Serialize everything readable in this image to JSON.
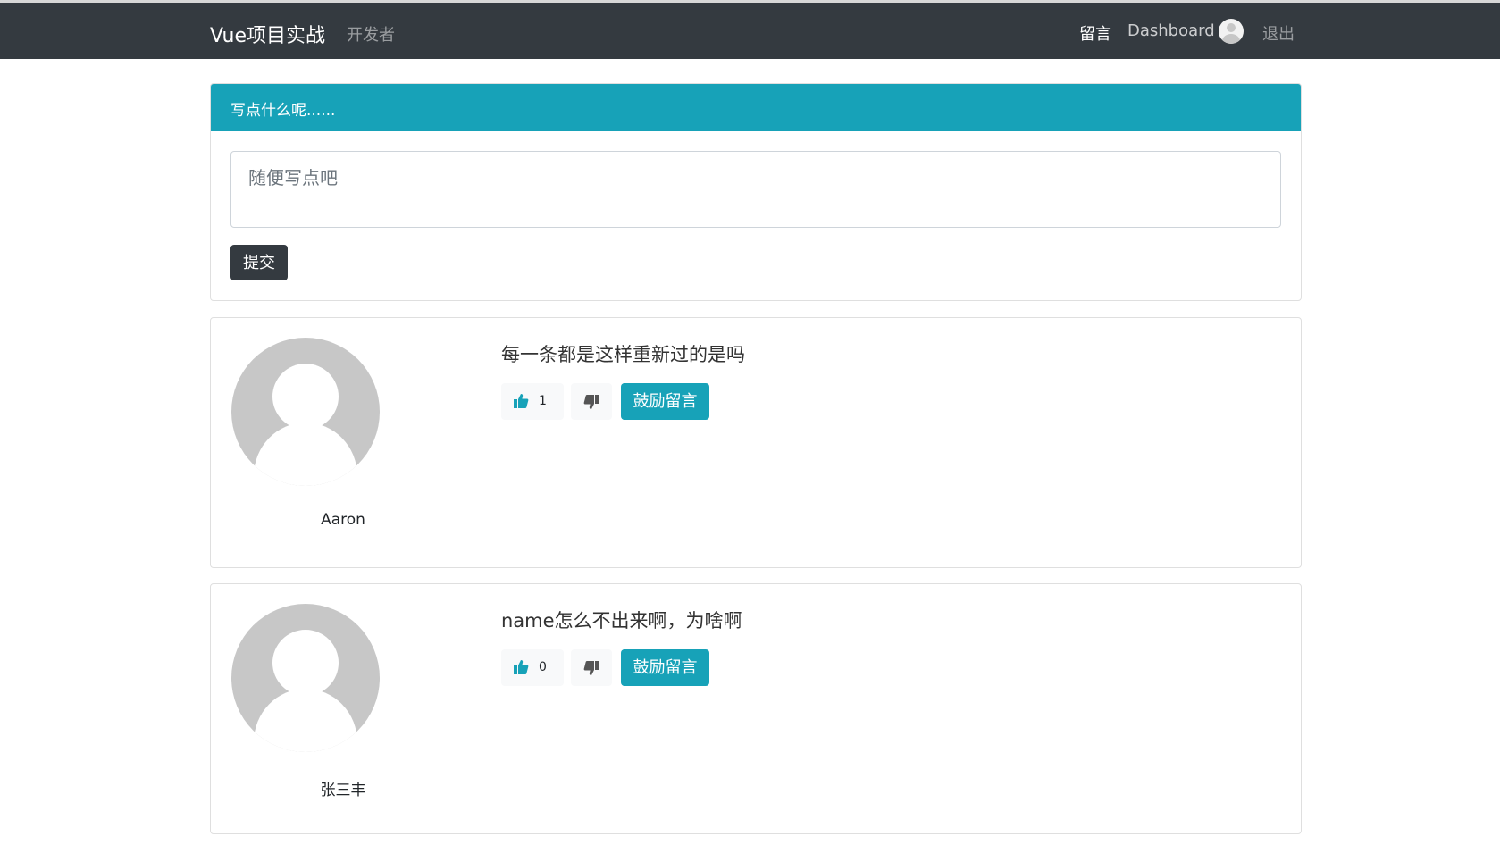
{
  "navbar": {
    "brand": "Vue项目实战",
    "developer": "开发者",
    "messages": "留言",
    "dashboard": "Dashboard",
    "logout": "退出"
  },
  "post_form": {
    "header": "写点什么呢......",
    "placeholder": "随便写点吧",
    "submit": "提交"
  },
  "messages": [
    {
      "author": "Aaron",
      "text": "每一条都是这样重新过的是吗",
      "likes": "1",
      "encourage": "鼓励留言"
    },
    {
      "author": "张三丰",
      "text": "name怎么不出来啊，为啥啊",
      "likes": "0",
      "encourage": "鼓励留言"
    }
  ],
  "colors": {
    "navbar": "#343a40",
    "accent": "#17a2b8",
    "like_icon": "#17a2b8",
    "dislike_icon": "#555555"
  },
  "icons": {
    "like": "thumbs-up-icon",
    "dislike": "thumbs-down-icon",
    "avatar": "default-avatar"
  }
}
